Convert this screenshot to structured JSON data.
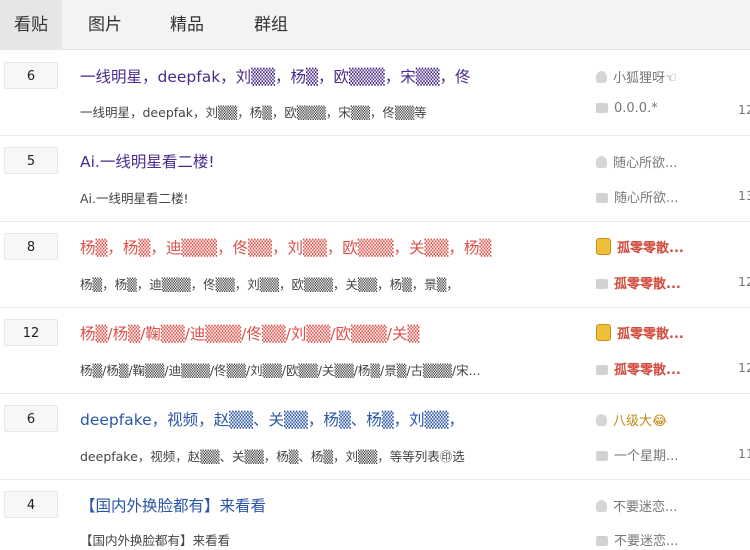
{
  "tabs": [
    "看贴",
    "图片",
    "精品",
    "群组"
  ],
  "threads": [
    {
      "replies": "6",
      "title": "一线明星，deepfak，刘▒▒，杨▒，欧▒▒▒，宋▒▒，佟",
      "excerpt": "一线明星，deepfak，刘▒▒，杨▒，欧▒▒▒，宋▒▒，佟▒▒等",
      "author": "小狐狸呀☜",
      "last_reply": "0.0.0.*",
      "date": "12"
    },
    {
      "replies": "5",
      "title": "Ai.一线明星看二楼!",
      "excerpt": "Ai.一线明星看二楼!",
      "author": "随心所欲...",
      "last_reply": "随心所欲...",
      "date": "13"
    },
    {
      "replies": "8",
      "title": "杨▒，杨▒，迪▒▒▒，佟▒▒，刘▒▒，欧▒▒▒，关▒▒，杨▒",
      "excerpt": "杨▒，杨▒，迪▒▒▒，佟▒▒，刘▒▒，欧▒▒▒，关▒▒，杨▒，景▒，",
      "author": "孤零零散...",
      "last_reply": "孤零零散...",
      "date": "12"
    },
    {
      "replies": "12",
      "title": "杨▒/杨▒/鞠▒▒/迪▒▒▒/佟▒▒/刘▒▒/欧▒▒▒/关▒",
      "excerpt": "杨▒/杨▒/鞠▒▒/迪▒▒▒/佟▒▒/刘▒▒/欧▒▒/关▒▒/杨▒/景▒/古▒▒▒/宋...",
      "author": "孤零零散...",
      "last_reply": "孤零零散...",
      "date": "12"
    },
    {
      "replies": "6",
      "title": "deepfake，视频，赵▒▒、关▒▒，杨▒、杨▒，刘▒▒，",
      "excerpt": "deepfake，视频，赵▒▒、关▒▒，杨▒、杨▒，刘▒▒，等等列表㊞选",
      "author": "八级大😂",
      "last_reply": "一个星期...",
      "date": "11"
    },
    {
      "replies": "4",
      "title": "【国内外换脸都有】来看看",
      "excerpt": "【国内外换脸都有】来看看",
      "author": "不要迷恋...",
      "last_reply": "不要迷恋...",
      "date": ""
    }
  ],
  "colors": {
    "title_purple": "#4a2a8c",
    "title_red": "#e0504a",
    "title_blue": "#2c55a8"
  }
}
